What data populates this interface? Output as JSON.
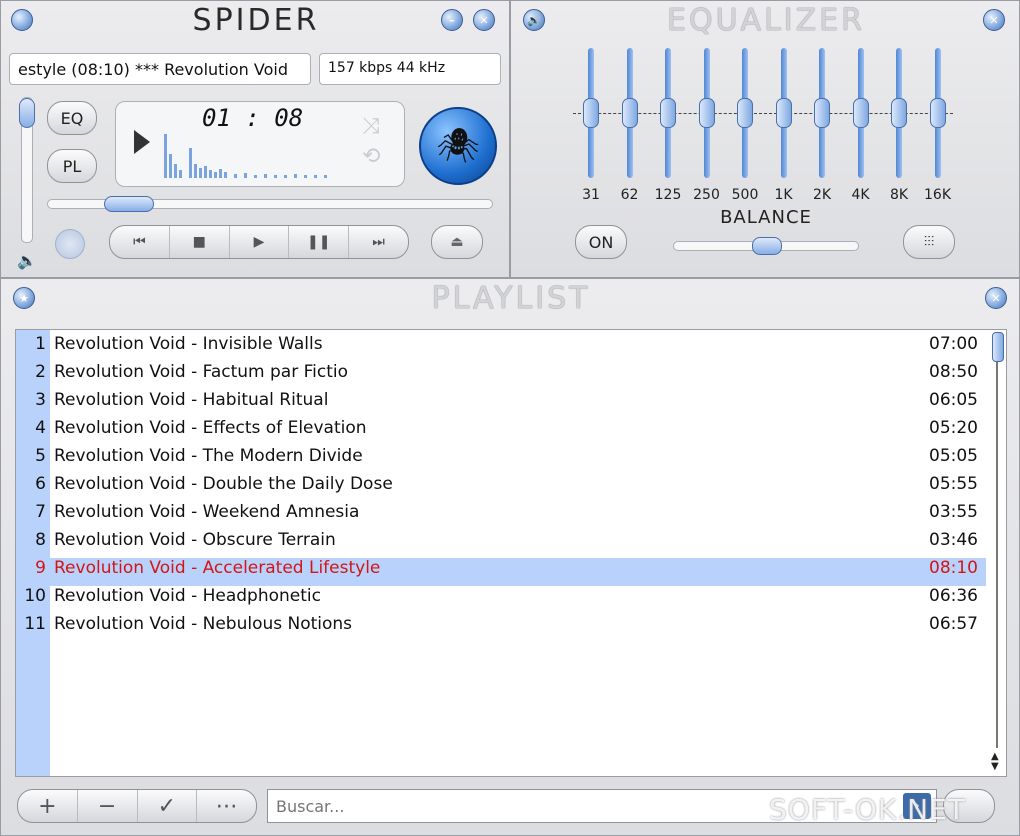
{
  "player": {
    "title": "SPIDER",
    "track_scroll": "estyle (08:10) *** Revolution Void",
    "bitrate": "157 kbps 44 kHz",
    "time": "01 : 08",
    "eq_button": "EQ",
    "pl_button": "PL",
    "volume_level": 0.95,
    "seek_position": 0.13
  },
  "equalizer": {
    "title": "EQUALIZER",
    "bands": [
      "31",
      "62",
      "125",
      "250",
      "500",
      "1K",
      "2K",
      "4K",
      "8K",
      "16K"
    ],
    "on_label": "ON",
    "balance_label": "BALANCE",
    "balance_value": 0.5
  },
  "playlist": {
    "title": "PLAYLIST",
    "search_placeholder": "Buscar...",
    "tracks": [
      {
        "num": "1",
        "name": "Revolution Void - Invisible Walls",
        "dur": "07:00"
      },
      {
        "num": "2",
        "name": "Revolution Void - Factum par Fictio",
        "dur": "08:50"
      },
      {
        "num": "3",
        "name": "Revolution Void - Habitual Ritual",
        "dur": "06:05"
      },
      {
        "num": "4",
        "name": "Revolution Void - Effects of Elevation",
        "dur": "05:20"
      },
      {
        "num": "5",
        "name": "Revolution Void - The Modern Divide",
        "dur": "05:05"
      },
      {
        "num": "6",
        "name": "Revolution Void - Double the Daily Dose",
        "dur": "05:55"
      },
      {
        "num": "7",
        "name": "Revolution Void - Weekend Amnesia",
        "dur": "03:55"
      },
      {
        "num": "8",
        "name": "Revolution Void - Obscure Terrain",
        "dur": "03:46"
      },
      {
        "num": "9",
        "name": "Revolution Void - Accelerated Lifestyle",
        "dur": "08:10"
      },
      {
        "num": "10",
        "name": "Revolution Void - Headphonetic",
        "dur": "06:36"
      },
      {
        "num": "11",
        "name": "Revolution Void - Nebulous Notions",
        "dur": "06:57"
      }
    ],
    "selected_index": 8
  },
  "watermark": "SOFT-OK.NET",
  "colors": {
    "accent": "#6f9ad6",
    "selected_row": "#b8d2fb",
    "selected_text": "#d21515",
    "spider_button": "#1e6fd0"
  }
}
